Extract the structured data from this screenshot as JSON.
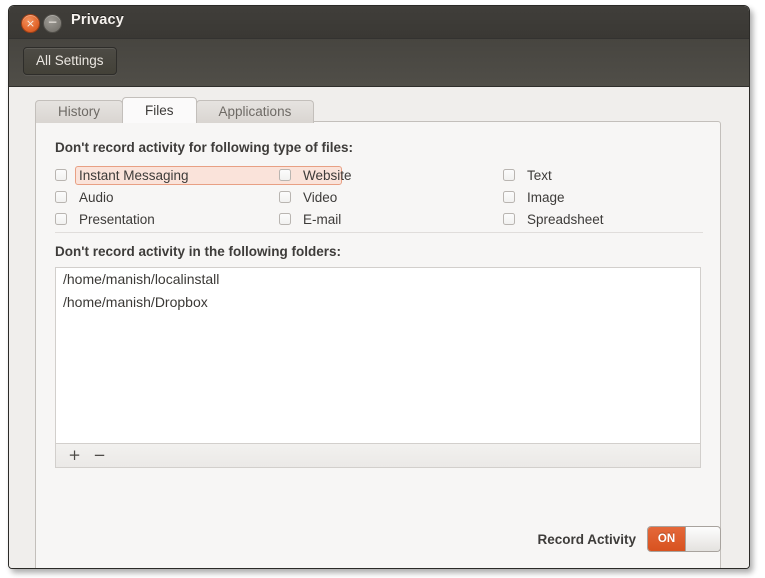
{
  "window": {
    "title": "Privacy",
    "close_icon": "close-icon",
    "close_glyph": "×",
    "minimize_icon": "minimize-icon",
    "minimize_glyph": "−"
  },
  "toolbar": {
    "all_settings_label": "All Settings"
  },
  "tabs": [
    {
      "label": "History",
      "selected": false
    },
    {
      "label": "Files",
      "selected": true
    },
    {
      "label": "Applications",
      "selected": false
    }
  ],
  "files_tab": {
    "types_heading": "Don't record activity for following type of files:",
    "file_types": [
      {
        "label": "Instant Messaging",
        "checked": false,
        "focused": true
      },
      {
        "label": "Website",
        "checked": false,
        "focused": false
      },
      {
        "label": "Text",
        "checked": false,
        "focused": false
      },
      {
        "label": "Audio",
        "checked": false,
        "focused": false
      },
      {
        "label": "Video",
        "checked": false,
        "focused": false
      },
      {
        "label": "Image",
        "checked": false,
        "focused": false
      },
      {
        "label": "Presentation",
        "checked": false,
        "focused": false
      },
      {
        "label": "E-mail",
        "checked": false,
        "focused": false
      },
      {
        "label": "Spreadsheet",
        "checked": false,
        "focused": false
      }
    ],
    "folders_heading": "Don't record activity in the following folders:",
    "folders": [
      "/home/manish/localinstall",
      "/home/manish/Dropbox"
    ],
    "list_toolbar": {
      "add_label": "+",
      "remove_label": "−"
    }
  },
  "footer": {
    "record_activity_label": "Record Activity",
    "switch_state_label": "ON",
    "switch_on": true
  },
  "colors": {
    "accent_orange": "#d8521f",
    "titlebar": "#3a3834",
    "panel_bg": "#f7f6f5",
    "focus_highlight": "#fae3da"
  }
}
